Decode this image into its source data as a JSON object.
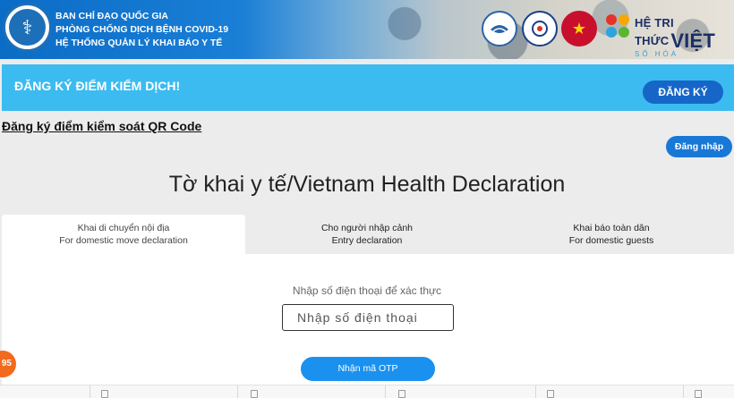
{
  "header": {
    "lines": [
      "BAN CHỈ ĐẠO QUỐC GIA",
      "PHÒNG CHỐNG DỊCH BỆNH COVID-19",
      "HỆ THỐNG QUẢN LÝ KHAI BÁO Y TẾ"
    ],
    "logo_icon": "ministry-of-health-emblem",
    "partners": {
      "htt_title": "HỆ TRI THỨC",
      "htt_strong": "VIỆT",
      "htt_sub": "SỐ HÓA"
    }
  },
  "banner": {
    "title": "ĐĂNG KÝ ĐIỂM KIỂM DỊCH!",
    "button": "ĐĂNG KÝ",
    "color": "#3bbbf0",
    "button_color": "#1666c8"
  },
  "qr_link": "Đăng ký điểm kiểm soát QR Code",
  "login_button": "Đăng nhập",
  "page_title": "Tờ khai y tế/Vietnam Health Declaration",
  "tabs": [
    {
      "line1": "Khai di chuyển nội địa",
      "line2": "For domestic move declaration",
      "active": true
    },
    {
      "line1": "Cho người nhập cảnh",
      "line2": "Entry declaration",
      "active": false
    },
    {
      "line1": "Khai báo toàn dân",
      "line2": "For domestic guests",
      "active": false
    }
  ],
  "form": {
    "phone_label": "Nhập số điện thoại để xác thực",
    "phone_placeholder": "Nhập số điện thoại",
    "otp_button": "Nhận mã OTP"
  },
  "badge": "95"
}
